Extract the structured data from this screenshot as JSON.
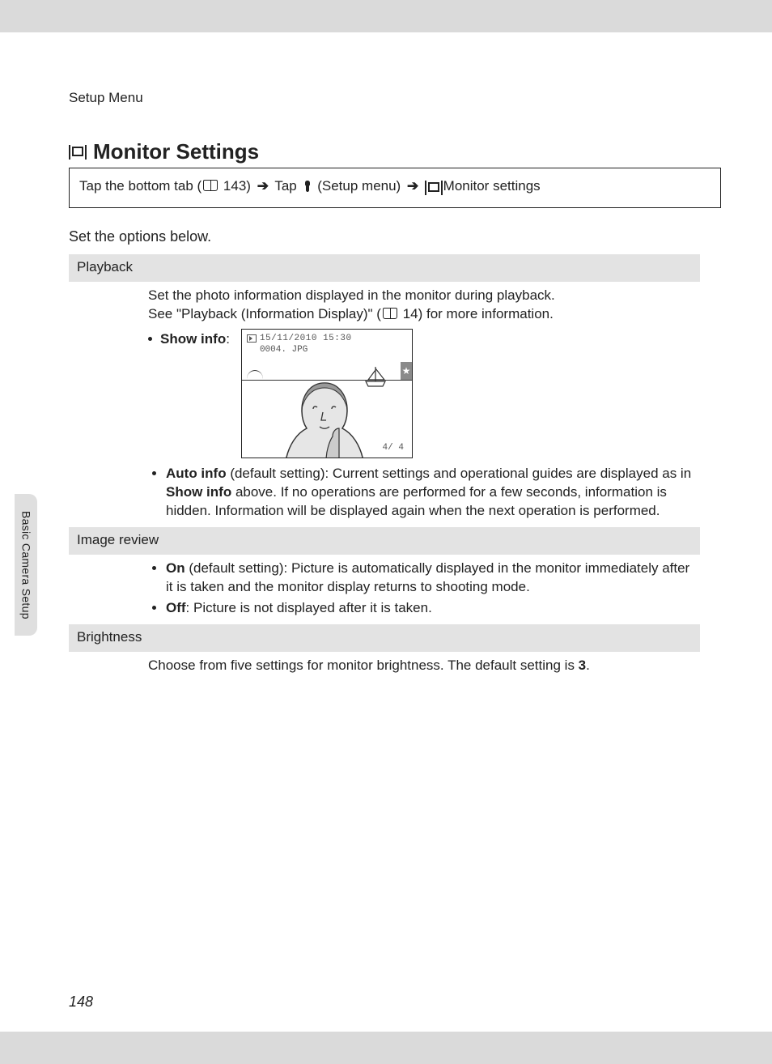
{
  "header": "Setup Menu",
  "title": "Monitor Settings",
  "nav": {
    "part1": "Tap the bottom tab (",
    "ref1": " 143) ",
    "part2": " Tap ",
    "part3": " (Setup menu) ",
    "part4": " Monitor settings"
  },
  "intro": "Set the options below.",
  "section_tab": "Basic Camera Setup",
  "page_number": "148",
  "playback": {
    "label": "Playback",
    "desc1": "Set the photo information displayed in the monitor during playback.",
    "desc2a": "See \"Playback (Information Display)\" (",
    "desc2_ref": " 14",
    "desc2b": ") for more information.",
    "show_info_label": "Show info",
    "auto_info_bold": "Auto info",
    "auto_info_rest1": " (default setting): Current settings and operational guides are displayed as in ",
    "auto_info_bold2": "Show info",
    "auto_info_rest2": " above. If no operations are performed for a few seconds, information is hidden. Information will be displayed again when the next operation is performed."
  },
  "preview": {
    "date": "15/11/2010 15:30",
    "file": "0004. JPG",
    "counter": "4/   4"
  },
  "image_review": {
    "label": "Image review",
    "on_bold": "On",
    "on_rest": " (default setting): Picture is automatically displayed in the monitor immediately after it is taken and the monitor display returns to shooting mode.",
    "off_bold": "Off",
    "off_rest": ": Picture is not displayed after it is taken."
  },
  "brightness": {
    "label": "Brightness",
    "desc_a": "Choose from five settings for monitor brightness. The default setting is ",
    "desc_b": "3",
    "desc_c": "."
  }
}
